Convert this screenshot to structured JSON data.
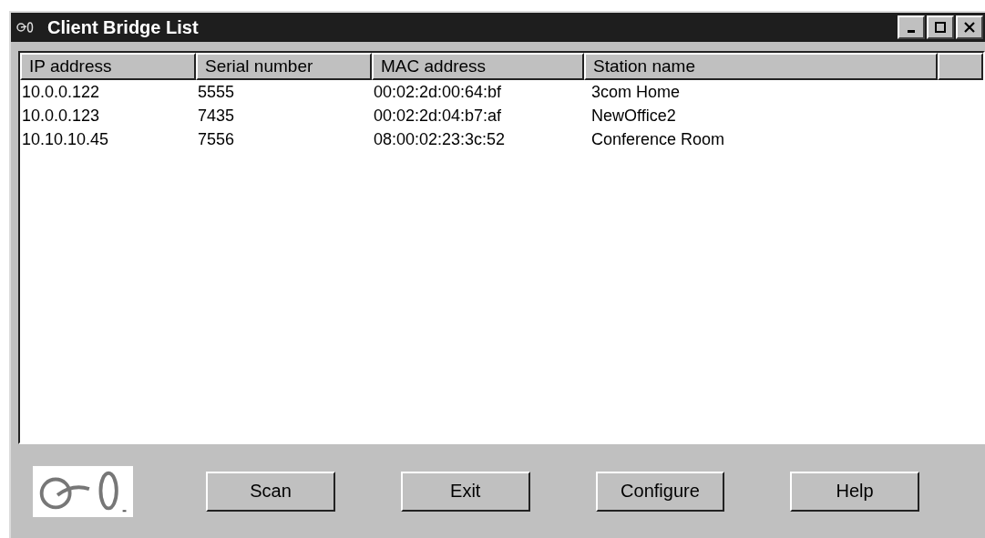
{
  "window": {
    "title": "Client Bridge List"
  },
  "table": {
    "columns": [
      "IP address",
      "Serial number",
      "MAC address",
      "Station name"
    ],
    "rows": [
      [
        "10.0.0.122",
        "5555",
        "00:02:2d:00:64:bf",
        "3com Home"
      ],
      [
        "10.0.0.123",
        "7435",
        "00:02:2d:04:b7:af",
        "NewOffice2"
      ],
      [
        "10.10.10.45",
        "7556",
        "08:00:02:23:3c:52",
        "Conference Room"
      ]
    ]
  },
  "buttons": [
    "Scan",
    "Exit",
    "Configure",
    "Help"
  ]
}
